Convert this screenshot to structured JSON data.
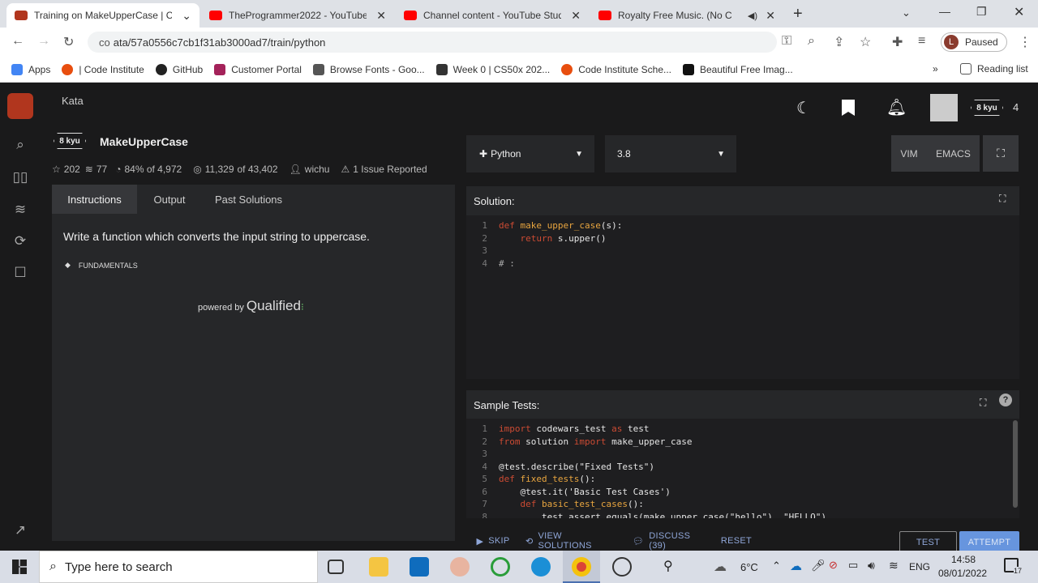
{
  "browser": {
    "tabs": [
      {
        "label": "Training on MakeUpperCase | Co",
        "color": "#b1361e",
        "active": true
      },
      {
        "label": "TheProgrammer2022 - YouTube",
        "color": "#ff0000"
      },
      {
        "label": "Channel content - YouTube Studi",
        "color": "#ff0000"
      },
      {
        "label": "Royalty Free Music. (No C",
        "color": "#ff0000"
      }
    ],
    "url": "ata/57a0556c7cb1f31ab3000ad7/train/python",
    "url_prefix": "co",
    "profile_initial": "L",
    "profile_status": "Paused",
    "bookmarks": [
      {
        "label": "Apps",
        "color": "#4285f4"
      },
      {
        "label": "| Code Institute",
        "color": "#e84e0f"
      },
      {
        "label": "GitHub",
        "color": "#222"
      },
      {
        "label": "Customer Portal",
        "color": "#a4225a"
      },
      {
        "label": "Browse Fonts - Goo...",
        "color": "#555"
      },
      {
        "label": "Week 0 | CS50x 202...",
        "color": "#333"
      },
      {
        "label": "Code Institute Sche...",
        "color": "#e84e0f"
      },
      {
        "label": "Beautiful Free Imag...",
        "color": "#111"
      }
    ],
    "reading_list": "Reading list"
  },
  "app": {
    "section": "Kata",
    "user_rank": "8 kyu",
    "honor": "4",
    "kata": {
      "rank": "8 kyu",
      "title": "MakeUpperCase",
      "stars": "202",
      "collections": "77",
      "satisfaction": "84% of 4,972",
      "completed": "11,329",
      "completed_of": "of 43,402",
      "author": "wichu",
      "issues": "1 Issue Reported"
    },
    "tabs": [
      "Instructions",
      "Output",
      "Past Solutions"
    ],
    "description": "Write a function which converts the input string to uppercase.",
    "tag": "FUNDAMENTALS",
    "powered_by": "powered by",
    "powered_brand": "Qualified",
    "language": "Python",
    "version": "3.8",
    "modes": [
      "VIM",
      "EMACS"
    ],
    "solution_label": "Solution:",
    "sample_tests_label": "Sample Tests:",
    "solution_code": [
      {
        "n": "1",
        "tokens": [
          {
            "t": "def ",
            "c": "kw"
          },
          {
            "t": "make_upper_case",
            "c": "fn"
          },
          {
            "t": "(s):",
            "c": "st"
          }
        ]
      },
      {
        "n": "2",
        "tokens": [
          {
            "t": "    ",
            "c": "st"
          },
          {
            "t": "return",
            "c": "kw"
          },
          {
            "t": " s.upper()",
            "c": "st"
          }
        ]
      },
      {
        "n": "3",
        "tokens": []
      },
      {
        "n": "4",
        "tokens": [
          {
            "t": "# : ",
            "c": "mt"
          }
        ]
      }
    ],
    "test_code": [
      {
        "n": "1",
        "tokens": [
          {
            "t": "import",
            "c": "kw"
          },
          {
            "t": " codewars_test ",
            "c": "st"
          },
          {
            "t": "as",
            "c": "kw"
          },
          {
            "t": " test",
            "c": "st"
          }
        ]
      },
      {
        "n": "2",
        "tokens": [
          {
            "t": "from",
            "c": "kw"
          },
          {
            "t": " solution ",
            "c": "st"
          },
          {
            "t": "import",
            "c": "kw"
          },
          {
            "t": " make_upper_case",
            "c": "st"
          }
        ]
      },
      {
        "n": "3",
        "tokens": []
      },
      {
        "n": "4",
        "tokens": [
          {
            "t": "@test.describe(\"Fixed Tests\")",
            "c": "st"
          }
        ]
      },
      {
        "n": "5",
        "tokens": [
          {
            "t": "def ",
            "c": "kw"
          },
          {
            "t": "fixed_tests",
            "c": "fn"
          },
          {
            "t": "():",
            "c": "st"
          }
        ]
      },
      {
        "n": "6",
        "tokens": [
          {
            "t": "    @test.it('Basic Test Cases')",
            "c": "st"
          }
        ]
      },
      {
        "n": "7",
        "tokens": [
          {
            "t": "    ",
            "c": "st"
          },
          {
            "t": "def ",
            "c": "kw"
          },
          {
            "t": "basic_test_cases",
            "c": "fn"
          },
          {
            "t": "():",
            "c": "st"
          }
        ]
      },
      {
        "n": "8",
        "tokens": [
          {
            "t": "        test.assert_equals(make_upper_case(\"hello\"), \"HELLO\")",
            "c": "st"
          }
        ]
      }
    ],
    "actions": {
      "skip": "SKIP",
      "view_solutions": "VIEW SOLUTIONS",
      "discuss": "DISCUSS (39)",
      "reset": "RESET",
      "test": "TEST",
      "attempt": "ATTEMPT"
    }
  },
  "taskbar": {
    "search_placeholder": "Type here to search",
    "weather": "6°C",
    "lang": "ENG",
    "time": "14:58",
    "date": "08/01/2022",
    "notif": "17"
  },
  "colors": {
    "accent": "#b1361e",
    "attempt": "#6795de",
    "test_border": "#888"
  }
}
